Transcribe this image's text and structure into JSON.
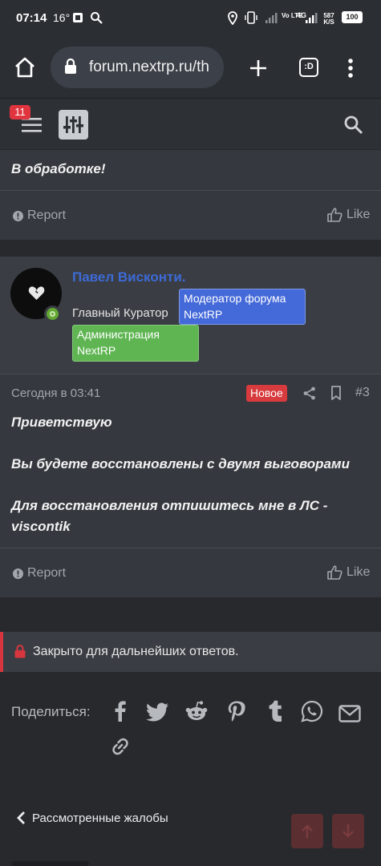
{
  "statusbar": {
    "time": "07:14",
    "temp": "16°",
    "vo_lte": "Vo LTE",
    "net": "4G",
    "speed": "587 K/S",
    "battery": "100"
  },
  "browser": {
    "url": "forum.nextrp.ru/th",
    "tabs_count": ":D"
  },
  "header": {
    "notif_count": "11"
  },
  "prev_post": {
    "text": "В обработке!",
    "report_label": "Report",
    "like_label": "Like"
  },
  "post": {
    "author": "Павел Висконти.",
    "user_title": "Главный Куратор",
    "banners": [
      {
        "line1": "Модератор форума",
        "line2": "NextRP"
      },
      {
        "line1": "Администрация",
        "line2": "NextRP"
      }
    ],
    "date": "Сегодня в 03:41",
    "new_badge": "Новое",
    "number": "#3",
    "lines": [
      "Приветствую",
      "Вы будете восстановлены с двумя выговорами",
      "Для восстановления отпишитесь мне в ЛС -",
      "viscontik"
    ],
    "report_label": "Report",
    "like_label": "Like"
  },
  "closed": {
    "text": "Закрыто для дальнейших ответов."
  },
  "share": {
    "label": "Поделиться:",
    "icons": [
      "facebook-icon",
      "twitter-icon",
      "reddit-icon",
      "pinterest-icon",
      "tumblr-icon",
      "whatsapp-icon",
      "email-icon",
      "link-icon"
    ]
  },
  "footer": {
    "back_label": "Рассмотренные жалобы"
  },
  "colors": {
    "accent_red": "#d83b3e",
    "username_blue": "#3d6ad6",
    "moderator_banner": "#4469d8",
    "admin_banner": "#5fb552"
  }
}
